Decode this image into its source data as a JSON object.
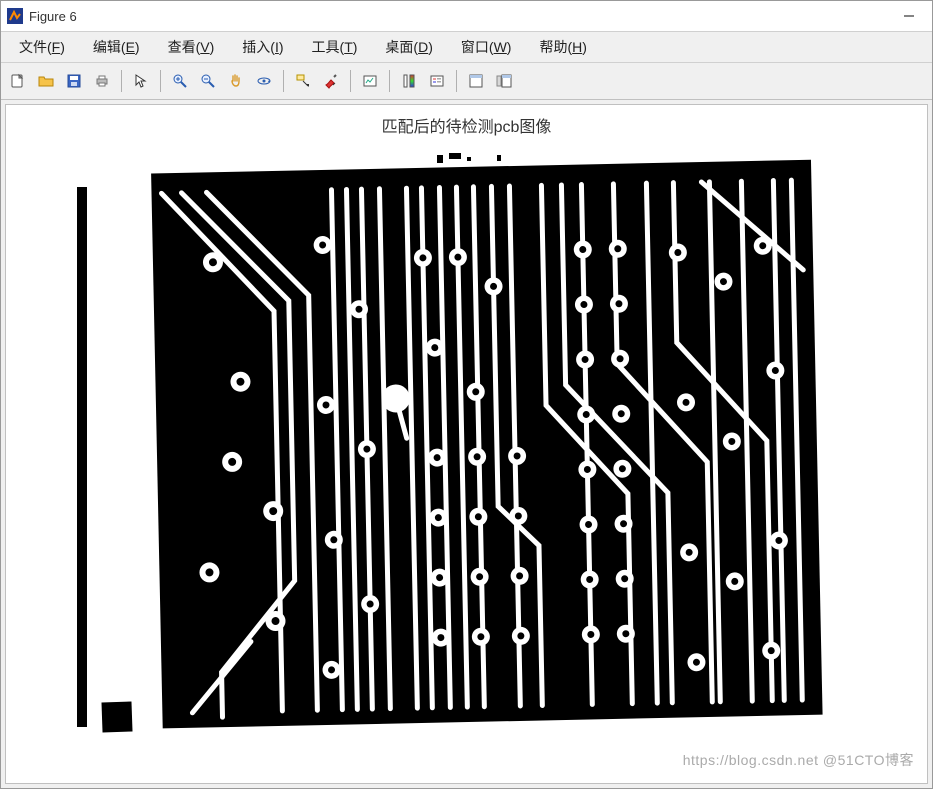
{
  "window": {
    "title": "Figure 6"
  },
  "menubar": {
    "items": [
      {
        "label": "文件",
        "accel": "F"
      },
      {
        "label": "编辑",
        "accel": "E"
      },
      {
        "label": "查看",
        "accel": "V"
      },
      {
        "label": "插入",
        "accel": "I"
      },
      {
        "label": "工具",
        "accel": "T"
      },
      {
        "label": "桌面",
        "accel": "D"
      },
      {
        "label": "窗口",
        "accel": "W"
      },
      {
        "label": "帮助",
        "accel": "H"
      }
    ]
  },
  "toolbar": {
    "groups": [
      [
        "new-figure",
        "open-file",
        "save-figure",
        "print-figure"
      ],
      [
        "edit-plot-arrow"
      ],
      [
        "zoom-in",
        "zoom-out",
        "pan",
        "rotate-3d"
      ],
      [
        "data-cursor",
        "brush"
      ],
      [
        "link-plot"
      ],
      [
        "insert-colorbar",
        "insert-legend"
      ],
      [
        "hide-plot-tools",
        "show-plot-tools"
      ]
    ]
  },
  "figure": {
    "title": "匹配后的待检测pcb图像"
  },
  "watermark": "https://blog.csdn.net @51CTO博客"
}
